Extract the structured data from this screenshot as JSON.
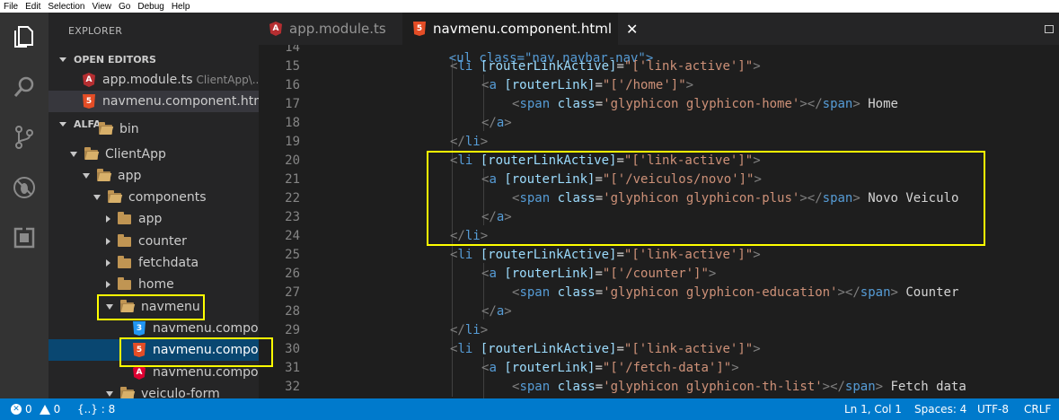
{
  "menubar": [
    "File",
    "Edit",
    "Selection",
    "View",
    "Go",
    "Debug",
    "Help"
  ],
  "sidebar": {
    "title": "EXPLORER",
    "open_editors_label": "OPEN EDITORS",
    "open_editors": [
      {
        "name": "app.module.ts",
        "path": "ClientApp\\...",
        "icon": "angular-file-icon"
      },
      {
        "name": "navmenu.component.htm...",
        "path": "",
        "icon": "html5-file-icon"
      }
    ],
    "project_label": "ALFA",
    "tree": [
      {
        "label": "bin",
        "icon": "folder-icon"
      },
      {
        "label": "ClientApp",
        "icon": "folder-open-icon"
      },
      {
        "label": "app",
        "icon": "folder-open-icon"
      },
      {
        "label": "components",
        "icon": "folder-open-icon"
      },
      {
        "label": "app",
        "icon": "folder-icon"
      },
      {
        "label": "counter",
        "icon": "folder-icon"
      },
      {
        "label": "fetchdata",
        "icon": "folder-icon"
      },
      {
        "label": "home",
        "icon": "folder-icon"
      },
      {
        "label": "navmenu",
        "icon": "folder-open-icon"
      },
      {
        "label": "navmenu.compo...",
        "icon": "css3-file-icon"
      },
      {
        "label": "navmenu.compo...",
        "icon": "html5-file-icon"
      },
      {
        "label": "navmenu.compo...",
        "icon": "angular-file-icon"
      },
      {
        "label": "veiculo-form",
        "icon": "folder-open-icon"
      }
    ]
  },
  "tabs": [
    {
      "label": "app.module.ts",
      "icon": "angular-file-icon",
      "active": false
    },
    {
      "label": "navmenu.component.html",
      "icon": "html5-file-icon",
      "active": true,
      "close": "✕"
    }
  ],
  "editor": {
    "top_partial": "<ul class=\"nav navbar-nav\">",
    "line_numbers": [
      "14",
      "15",
      "16",
      "17",
      "18",
      "19",
      "20",
      "21",
      "22",
      "23",
      "24",
      "25",
      "26",
      "27",
      "28",
      "29",
      "30",
      "31",
      "32"
    ],
    "lines": [
      "<ul class=\"nav navbar-nav\">",
      "<li [routerLinkActive]=\"['link-active']\">",
      "<a [routerLink]=\"['/home']\">",
      "<span class='glyphicon glyphicon-home'></span> Home",
      "</a>",
      "</li>",
      "<li [routerLinkActive]=\"['link-active']\">",
      "<a [routerLink]=\"['/veiculos/novo']\">",
      "<span class='glyphicon glyphicon-plus'></span> Novo Veiculo",
      "</a>",
      "</li>",
      "<li [routerLinkActive]=\"['link-active']\">",
      "<a [routerLink]=\"['/counter']\">",
      "<span class='glyphicon glyphicon-education'></span> Counter",
      "</a>",
      "</li>",
      "<li [routerLinkActive]=\"['link-active']\">",
      "<a [routerLink]=\"['/fetch-data']\">",
      "<span class='glyphicon glyphicon-th-list'></span> Fetch data"
    ]
  },
  "statusbar": {
    "errors": "0",
    "warnings": "0",
    "braces": "{..} : 8",
    "position": "Ln 1, Col 1",
    "spaces": "Spaces: 4",
    "encoding": "UTF-8",
    "eol": "CRLF"
  },
  "colors": {
    "highlight": "#ffff00",
    "status_bar": "#007acc",
    "selection": "#094771"
  }
}
